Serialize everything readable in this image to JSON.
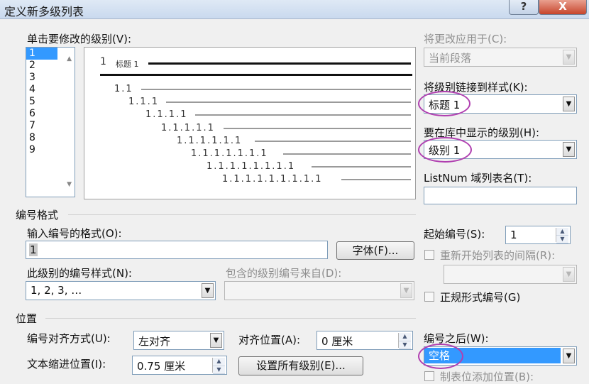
{
  "window": {
    "title": "定义新多级列表",
    "help": "?",
    "close": "X"
  },
  "levels": {
    "label": "单击要修改的级别(V):",
    "items": [
      "1",
      "2",
      "3",
      "4",
      "5",
      "6",
      "7",
      "8",
      "9"
    ],
    "selected": "1",
    "scroll_up": "▲",
    "scroll_down": "▼"
  },
  "preview": {
    "top_number": "1",
    "top_text": "标题 1",
    "rows": [
      "1.1",
      "1.1.1",
      "1.1.1.1",
      "1.1.1.1.1",
      "1.1.1.1.1.1",
      "1.1.1.1.1.1.1",
      "1.1.1.1.1.1.1.1",
      "1.1.1.1.1.1.1.1.1"
    ]
  },
  "right": {
    "apply_to_label": "将更改应用于(C):",
    "apply_to_value": "当前段落",
    "link_style_label": "将级别链接到样式(K):",
    "link_style_value": "标题 1",
    "gallery_level_label": "要在库中显示的级别(H):",
    "gallery_level_value": "级别 1",
    "listnum_label": "ListNum 域列表名(T):",
    "listnum_value": ""
  },
  "number_format": {
    "section": "编号格式",
    "enter_format_label": "输入编号的格式(O):",
    "format_value": "1",
    "font_button": "字体(F)...",
    "style_label": "此级别的编号样式(N):",
    "style_value": "1, 2, 3, …",
    "include_from_label": "包含的级别编号来自(D):",
    "start_at_label": "起始编号(S):",
    "start_at_value": "1",
    "restart_label": "重新开始列表的间隔(R):",
    "legal_label": "正规形式编号(G)"
  },
  "position": {
    "section": "位置",
    "align_label": "编号对齐方式(U):",
    "align_value": "左对齐",
    "aligned_at_label": "对齐位置(A):",
    "aligned_at_value": "0 厘米",
    "indent_label": "文本缩进位置(I):",
    "indent_value": "0.75 厘米",
    "set_all_button": "设置所有级别(E)...",
    "follow_label": "编号之后(W):",
    "follow_value": "空格",
    "tab_stop_label": "制表位添加位置(B):"
  },
  "icons": {
    "dropdown": "▼",
    "spin_up": "▲",
    "spin_down": "▼"
  }
}
